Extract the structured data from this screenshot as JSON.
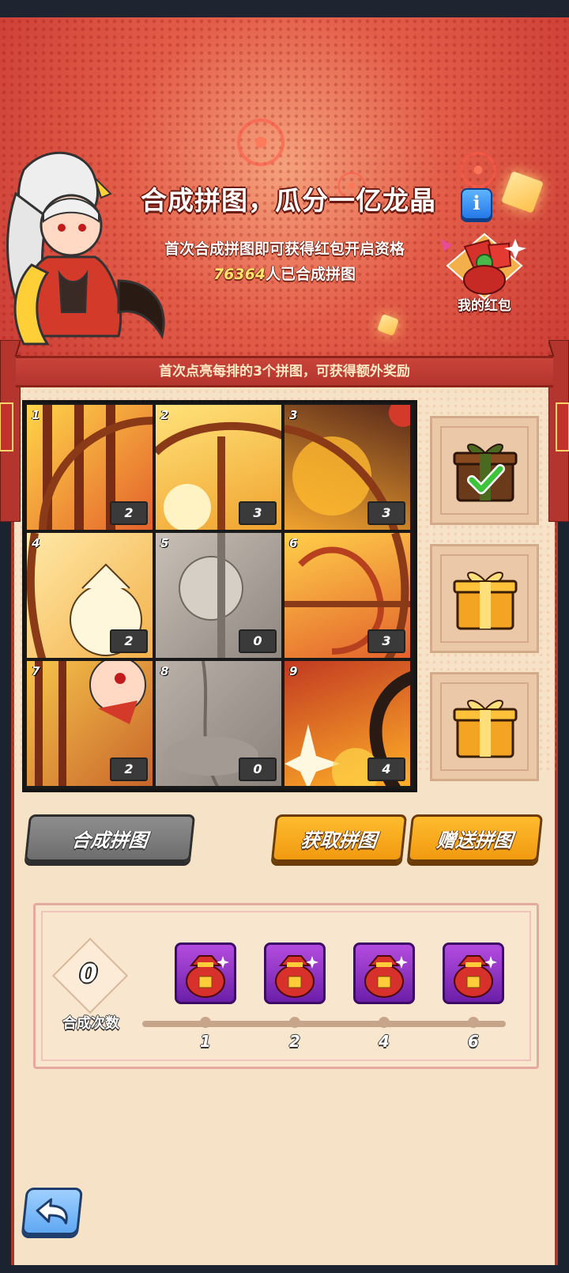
{
  "header": {
    "title": "合成拼图，瓜分一亿龙晶",
    "info_icon": "i",
    "subtitle": "首次合成拼图即可获得红包开启资格",
    "count_number": "76364",
    "count_suffix": "人已合成拼图",
    "red_packet_label": "我的红包"
  },
  "banner": {
    "text": "首次点亮每排的3个拼图，可获得额外奖励"
  },
  "puzzle": {
    "pieces": [
      {
        "index": "1",
        "count": "2"
      },
      {
        "index": "2",
        "count": "3"
      },
      {
        "index": "3",
        "count": "3"
      },
      {
        "index": "4",
        "count": "2"
      },
      {
        "index": "5",
        "count": "0"
      },
      {
        "index": "6",
        "count": "3"
      },
      {
        "index": "7",
        "count": "2"
      },
      {
        "index": "8",
        "count": "0"
      },
      {
        "index": "9",
        "count": "4"
      }
    ]
  },
  "rewards": [
    {
      "icon": "gift-box-claimed-icon",
      "claimed": true
    },
    {
      "icon": "gift-box-icon",
      "claimed": false
    },
    {
      "icon": "gift-box-icon",
      "claimed": false
    }
  ],
  "buttons": {
    "combine": "合成拼图",
    "get": "获取拼图",
    "give": "赠送拼图"
  },
  "progress": {
    "count_value": "0",
    "count_label": "合成次数",
    "milestones": [
      "1",
      "2",
      "4",
      "6"
    ]
  },
  "colors": {
    "accent_red": "#c9443a",
    "button_orange": "#f19a10",
    "button_gray": "#7d7d7d",
    "milestone_purple": "#8a2fc6"
  }
}
